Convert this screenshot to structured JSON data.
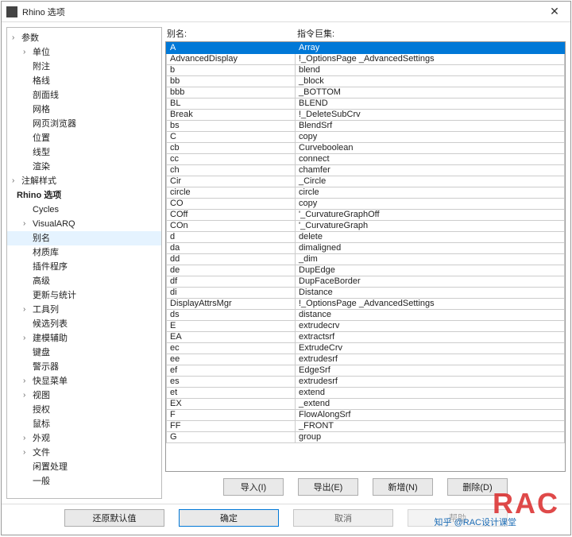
{
  "window": {
    "title": "Rhino 选项",
    "close": "✕"
  },
  "tree": [
    {
      "label": "参数",
      "lvl": 0,
      "group": true
    },
    {
      "label": "单位",
      "lvl": 1,
      "group": true
    },
    {
      "label": "附注",
      "lvl": 1,
      "group": false
    },
    {
      "label": "格线",
      "lvl": 1,
      "group": false
    },
    {
      "label": "剖面线",
      "lvl": 1,
      "group": false
    },
    {
      "label": "网格",
      "lvl": 1,
      "group": false
    },
    {
      "label": "网页浏览器",
      "lvl": 1,
      "group": false
    },
    {
      "label": "位置",
      "lvl": 1,
      "group": false
    },
    {
      "label": "线型",
      "lvl": 1,
      "group": false
    },
    {
      "label": "渲染",
      "lvl": 1,
      "group": false
    },
    {
      "label": "注解样式",
      "lvl": 0,
      "group": true
    },
    {
      "label": "Rhino 选项",
      "lvl": 0,
      "group": false,
      "bold": true
    },
    {
      "label": "Cycles",
      "lvl": 1,
      "group": false
    },
    {
      "label": "VisualARQ",
      "lvl": 1,
      "group": true
    },
    {
      "label": "别名",
      "lvl": 1,
      "group": false,
      "selected": true
    },
    {
      "label": "材质库",
      "lvl": 1,
      "group": false
    },
    {
      "label": "插件程序",
      "lvl": 1,
      "group": false
    },
    {
      "label": "高级",
      "lvl": 1,
      "group": false
    },
    {
      "label": "更新与统计",
      "lvl": 1,
      "group": false
    },
    {
      "label": "工具列",
      "lvl": 1,
      "group": true
    },
    {
      "label": "候选列表",
      "lvl": 1,
      "group": false
    },
    {
      "label": "建模辅助",
      "lvl": 1,
      "group": true
    },
    {
      "label": "键盘",
      "lvl": 1,
      "group": false
    },
    {
      "label": "警示器",
      "lvl": 1,
      "group": false
    },
    {
      "label": "快显菜单",
      "lvl": 1,
      "group": true
    },
    {
      "label": "视图",
      "lvl": 1,
      "group": true
    },
    {
      "label": "授权",
      "lvl": 1,
      "group": false
    },
    {
      "label": "鼠标",
      "lvl": 1,
      "group": false
    },
    {
      "label": "外观",
      "lvl": 1,
      "group": true
    },
    {
      "label": "文件",
      "lvl": 1,
      "group": true
    },
    {
      "label": "闲置处理",
      "lvl": 1,
      "group": false
    },
    {
      "label": "一般",
      "lvl": 1,
      "group": false
    }
  ],
  "labels": {
    "alias": "别名:",
    "macro": "指令巨集:"
  },
  "rows": [
    {
      "a": "A",
      "b": "Array",
      "sel": true
    },
    {
      "a": "AdvancedDisplay",
      "b": "!_OptionsPage _AdvancedSettings"
    },
    {
      "a": "b",
      "b": "blend"
    },
    {
      "a": "bb",
      "b": "_block"
    },
    {
      "a": "bbb",
      "b": "_BOTTOM"
    },
    {
      "a": "BL",
      "b": "BLEND"
    },
    {
      "a": "Break",
      "b": "!_DeleteSubCrv"
    },
    {
      "a": "bs",
      "b": "BlendSrf"
    },
    {
      "a": "C",
      "b": "copy"
    },
    {
      "a": "cb",
      "b": "Curveboolean"
    },
    {
      "a": "cc",
      "b": "connect"
    },
    {
      "a": "ch",
      "b": "chamfer"
    },
    {
      "a": "Cir",
      "b": "_Circle"
    },
    {
      "a": "circle",
      "b": "circle"
    },
    {
      "a": "CO",
      "b": "copy"
    },
    {
      "a": "COff",
      "b": "'_CurvatureGraphOff"
    },
    {
      "a": "COn",
      "b": "'_CurvatureGraph"
    },
    {
      "a": "d",
      "b": "delete"
    },
    {
      "a": "da",
      "b": "dimaligned"
    },
    {
      "a": "dd",
      "b": "_dim"
    },
    {
      "a": "de",
      "b": "DupEdge"
    },
    {
      "a": "df",
      "b": "DupFaceBorder"
    },
    {
      "a": "di",
      "b": "Distance"
    },
    {
      "a": "DisplayAttrsMgr",
      "b": "!_OptionsPage _AdvancedSettings"
    },
    {
      "a": "ds",
      "b": "distance"
    },
    {
      "a": "E",
      "b": "extrudecrv"
    },
    {
      "a": "EA",
      "b": "extractsrf"
    },
    {
      "a": "ec",
      "b": "ExtrudeCrv"
    },
    {
      "a": "ee",
      "b": "extrudesrf"
    },
    {
      "a": "ef",
      "b": "EdgeSrf"
    },
    {
      "a": "es",
      "b": "extrudesrf"
    },
    {
      "a": "et",
      "b": "extend"
    },
    {
      "a": "EX",
      "b": "_extend"
    },
    {
      "a": "F",
      "b": "FlowAlongSrf"
    },
    {
      "a": "FF",
      "b": "_FRONT"
    },
    {
      "a": "G",
      "b": "group"
    }
  ],
  "buttons": {
    "import": "导入(I)",
    "export": "导出(E)",
    "new": "新增(N)",
    "delete": "删除(D)",
    "restore": "还原默认值",
    "ok": "确定",
    "cancel": "取消",
    "help": "帮助"
  },
  "watermark": {
    "logo": "RAC",
    "text": "知乎 @RAC设计课堂"
  }
}
